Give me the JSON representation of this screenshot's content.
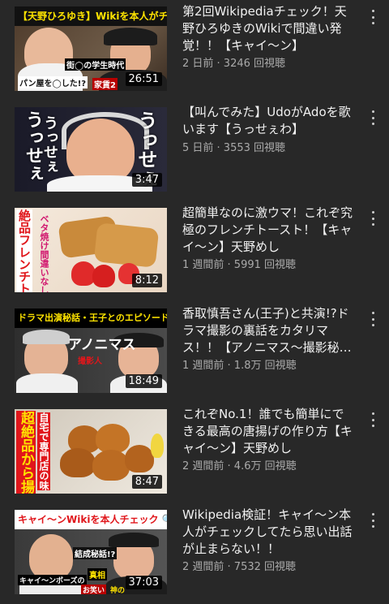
{
  "videos": [
    {
      "title": "第2回Wikipediaチェック！天野ひろゆきのWikiで間違い発覚！！【キャイ〜ン】",
      "meta": "2 日前 · 3246 回視聴",
      "duration": "26:51",
      "banner": "【天野ひろゆき】Wikiを本人がチェック!!",
      "thumb_texts": [
        "街◯の学生時代",
        "パン屋を◯した!?",
        "家賃2"
      ]
    },
    {
      "title": "【叫んでみた】UdoがAdoを歌います【うっせぇわ】",
      "meta": "5 日前 · 3553 回視聴",
      "duration": "3:47",
      "thumb_texts": [
        "うっせぇ",
        "うっせぇ",
        "うっせぇ"
      ]
    },
    {
      "title": "超簡単なのに激ウマ！これぞ究極のフレンチトースト！【キャイ〜ン】天野めし",
      "meta": "1 週間前 · 5991 回視聴",
      "duration": "8:12",
      "thumb_texts": [
        "絶品フレンチトースト",
        "ベタ焼け間違いなし"
      ]
    },
    {
      "title": "香取慎吾さん(王子)と共演!?ドラマ撮影の裏話をカタリマス！！【アノニマス〜撮影秘話〜】",
      "meta": "1 週間前 · 1.8万 回視聴",
      "duration": "18:49",
      "banner": "ドラマ出演秘話・王子とのエピソード",
      "thumb_texts": [
        "アノニマス",
        "撮影人"
      ]
    },
    {
      "title": "これぞNo.1！誰でも簡単にできる最高の唐揚げの作り方【キャイ〜ン】天野めし",
      "meta": "2 週間前 · 4.6万 回視聴",
      "duration": "8:47",
      "thumb_texts": [
        "超絶品から揚げ",
        "自宅で専門店の味"
      ]
    },
    {
      "title": "Wikipedia検証！キャイ〜ン本人がチェックしてたら思い出話が止まらない！！",
      "meta": "2 週間前 · 7532 回視聴",
      "duration": "37:03",
      "banner": "キャイ〜ンWikiを本人チェック",
      "thumb_texts": [
        "結成秘話!?",
        "キャイ〜ンボーズの",
        "お笑い",
        "真相",
        "神の"
      ]
    }
  ],
  "colors": {
    "background": "#282828",
    "title": "#f1f1f1",
    "meta": "#aaaaaa",
    "banner_yellow": "#ffe400",
    "accent_red": "#e0161b"
  }
}
